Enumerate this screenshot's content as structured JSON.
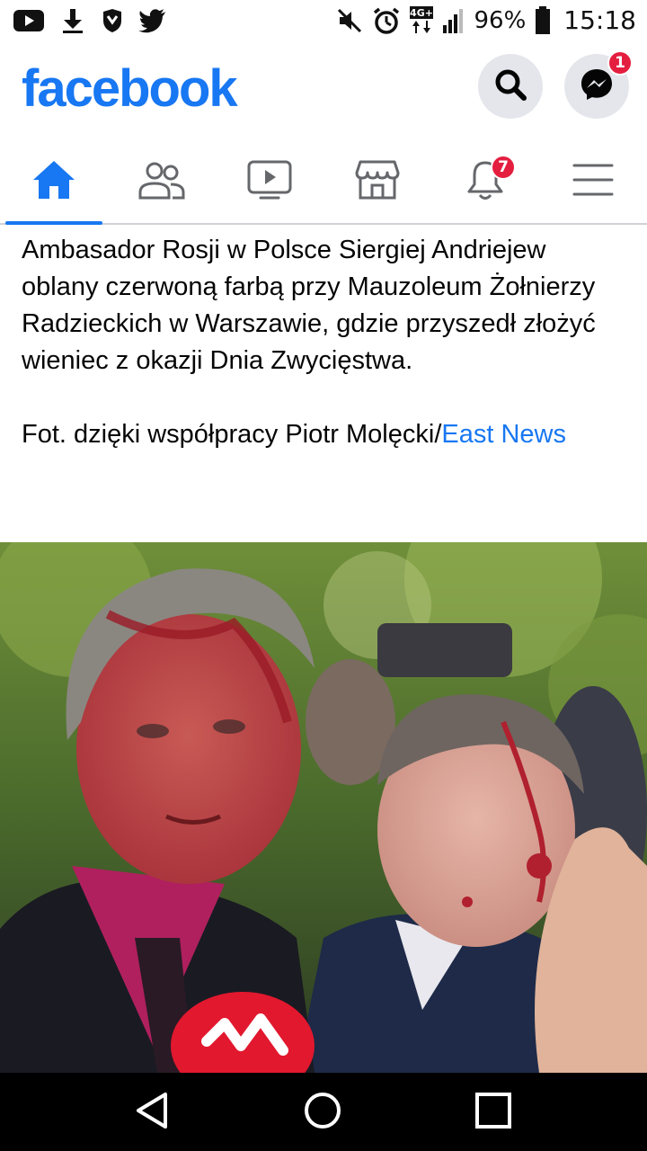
{
  "status_bar": {
    "left_icons": [
      "youtube-icon",
      "download-icon",
      "shield-app-icon",
      "twitter-icon"
    ],
    "right_icons": [
      "mute-icon",
      "alarm-icon",
      "network-4g-icon",
      "signal-icon",
      "battery-icon"
    ],
    "network_label": "4G+",
    "battery": "96%",
    "time": "15:18"
  },
  "header": {
    "logo": "facebook",
    "brand_color": "#1877f2",
    "messenger_badge": "1"
  },
  "tabs": [
    {
      "icon": "home-icon",
      "active": true
    },
    {
      "icon": "friends-icon",
      "active": false
    },
    {
      "icon": "watch-icon",
      "active": false
    },
    {
      "icon": "marketplace-icon",
      "active": false
    },
    {
      "icon": "notifications-icon",
      "active": false,
      "badge": "7"
    },
    {
      "icon": "menu-icon",
      "active": false
    }
  ],
  "post": {
    "body": "Ambasador Rosji w Polsce Siergiej Andriejew oblany czerwoną farbą przy Mauzoleum Żołnierzy Radzieckich w Warszawie, gdzie przyszedł złożyć wieniec z okazji Dnia Zwycięstwa.",
    "credit_prefix": "Fot. dzięki współpracy Piotr Molęcki/",
    "credit_link": "East News"
  },
  "nav_bar": {
    "buttons": [
      "back-icon",
      "home-circle-icon",
      "recents-icon"
    ]
  }
}
